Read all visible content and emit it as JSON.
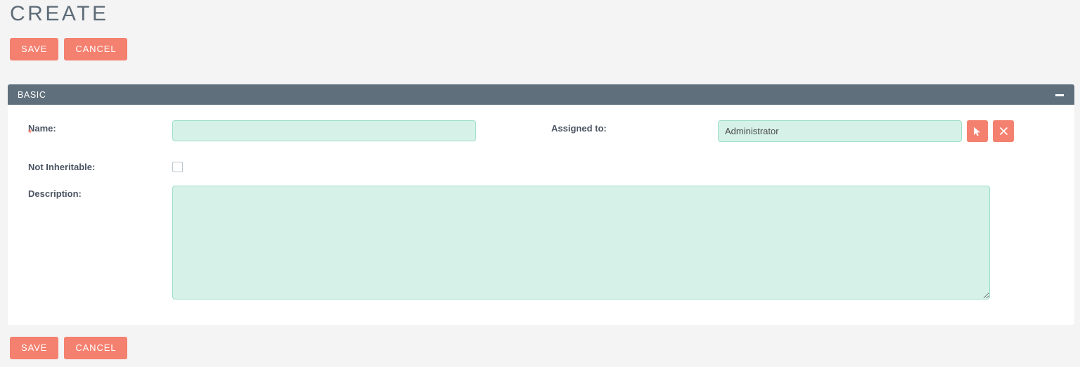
{
  "page": {
    "title": "CREATE",
    "background_color": "#f4f4f4",
    "accent_color": "#f4806f",
    "panel_header_color": "#5f6f7c",
    "field_fill_color": "#d6f2e8",
    "field_border_color": "#9fdfc8"
  },
  "actions": {
    "save_label": "SAVE",
    "cancel_label": "CANCEL"
  },
  "panel": {
    "title": "BASIC",
    "collapse_icon": "minus-icon"
  },
  "form": {
    "name": {
      "label": "Name:",
      "required_marker": "*",
      "value": "",
      "placeholder": ""
    },
    "assigned_to": {
      "label": "Assigned to:",
      "value": "Administrator",
      "placeholder": "",
      "select_icon": "cursor-arrow-icon",
      "clear_icon": "close-x-icon"
    },
    "not_inheritable": {
      "label": "Not Inheritable:",
      "checked": false
    },
    "description": {
      "label": "Description:",
      "value": "",
      "placeholder": ""
    }
  }
}
